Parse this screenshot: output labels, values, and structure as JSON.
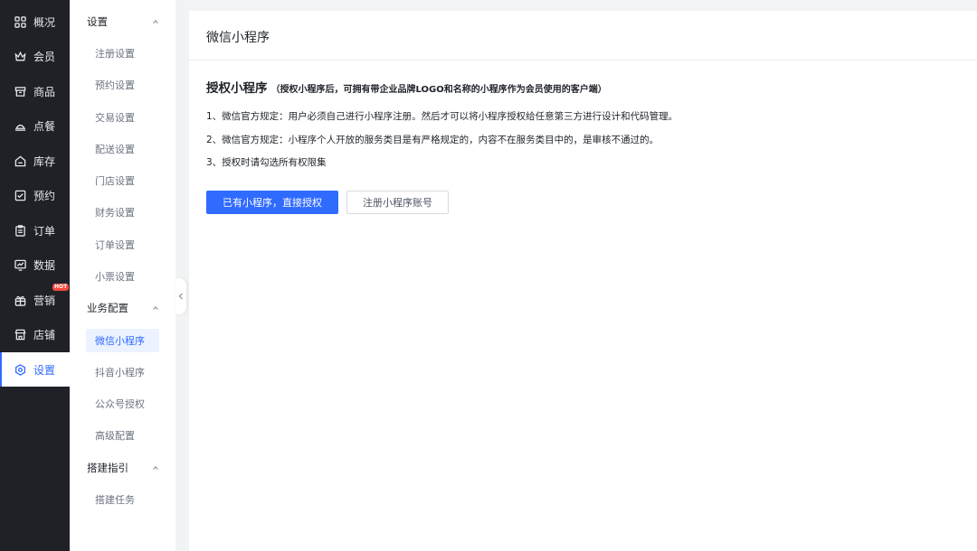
{
  "nav": [
    {
      "label": "概况",
      "icon": "grid-icon"
    },
    {
      "label": "会员",
      "icon": "crown-icon"
    },
    {
      "label": "商品",
      "icon": "store-icon"
    },
    {
      "label": "点餐",
      "icon": "dish-icon"
    },
    {
      "label": "库存",
      "icon": "inventory-icon"
    },
    {
      "label": "预约",
      "icon": "calendar-check-icon"
    },
    {
      "label": "订单",
      "icon": "clipboard-icon"
    },
    {
      "label": "数据",
      "icon": "monitor-chart-icon"
    },
    {
      "label": "营销",
      "icon": "gift-icon",
      "badge": "HOT"
    },
    {
      "label": "店铺",
      "icon": "shop-icon"
    },
    {
      "label": "设置",
      "icon": "settings-icon",
      "active": true
    }
  ],
  "subnav": {
    "groups": [
      {
        "label": "设置",
        "items": [
          "注册设置",
          "预约设置",
          "交易设置",
          "配送设置",
          "门店设置",
          "财务设置",
          "订单设置",
          "小票设置"
        ]
      },
      {
        "label": "业务配置",
        "items": [
          "微信小程序",
          "抖音小程序",
          "公众号授权",
          "高级配置"
        ]
      },
      {
        "label": "搭建指引",
        "items": [
          "搭建任务"
        ]
      }
    ],
    "active_item": "微信小程序"
  },
  "main": {
    "title": "微信小程序",
    "section_title": "授权小程序",
    "section_note": "（授权小程序后，可拥有带企业品牌LOGO和名称的小程序作为会员使用的客户端）",
    "rules": [
      "1、微信官方规定：用户必须自己进行小程序注册。然后才可以将小程序授权给任意第三方进行设计和代码管理。",
      "2、微信官方规定：小程序个人开放的服务类目是有严格规定的，内容不在服务类目中的，是审核不通过的。",
      "3、授权时请勾选所有权限集"
    ],
    "primary_button": "已有小程序，直接授权",
    "secondary_button": "注册小程序账号"
  },
  "colors": {
    "accent": "#2f6bff",
    "sidebar_bg": "#1f2127",
    "hot_badge": "#f5483b"
  }
}
